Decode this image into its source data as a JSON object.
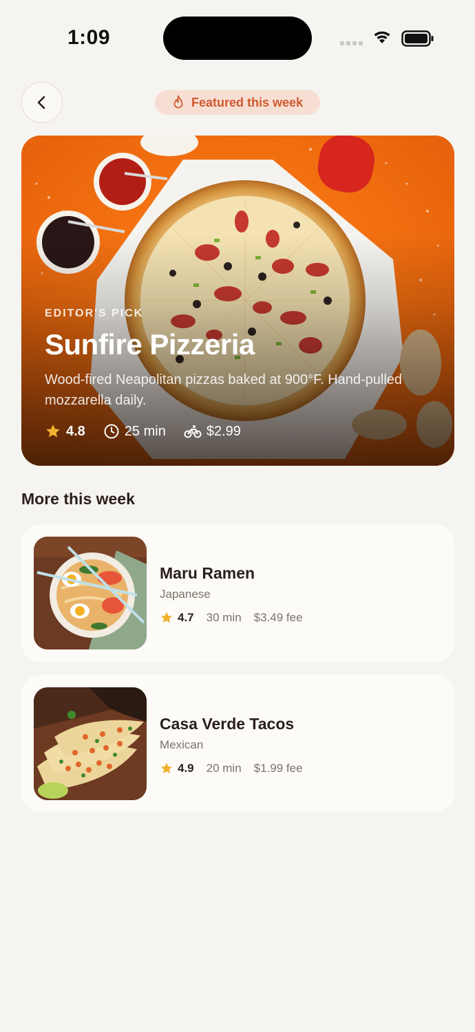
{
  "status": {
    "time": "1:09"
  },
  "header": {
    "featured_label": "Featured this week"
  },
  "hero": {
    "eyebrow": "EDITOR'S PICK",
    "title": "Sunfire Pizzeria",
    "description": "Wood-fired Neapolitan pizzas baked at 900°F. Hand-pulled mozzarella daily.",
    "rating": "4.8",
    "time": "25 min",
    "delivery_fee": "$2.99"
  },
  "section": {
    "title": "More this week"
  },
  "restaurants": [
    {
      "name": "Maru Ramen",
      "cuisine": "Japanese",
      "rating": "4.7",
      "time": "30 min",
      "fee": "$3.49 fee"
    },
    {
      "name": "Casa Verde Tacos",
      "cuisine": "Mexican",
      "rating": "4.9",
      "time": "20 min",
      "fee": "$1.99 fee"
    }
  ],
  "colors": {
    "accent": "#cf5a2f",
    "star": "#f2b230",
    "background": "#f6f4f0"
  },
  "icons": [
    "back-chevron-icon",
    "flame-icon",
    "star-icon",
    "clock-icon",
    "bike-icon",
    "wifi-icon",
    "battery-icon"
  ]
}
